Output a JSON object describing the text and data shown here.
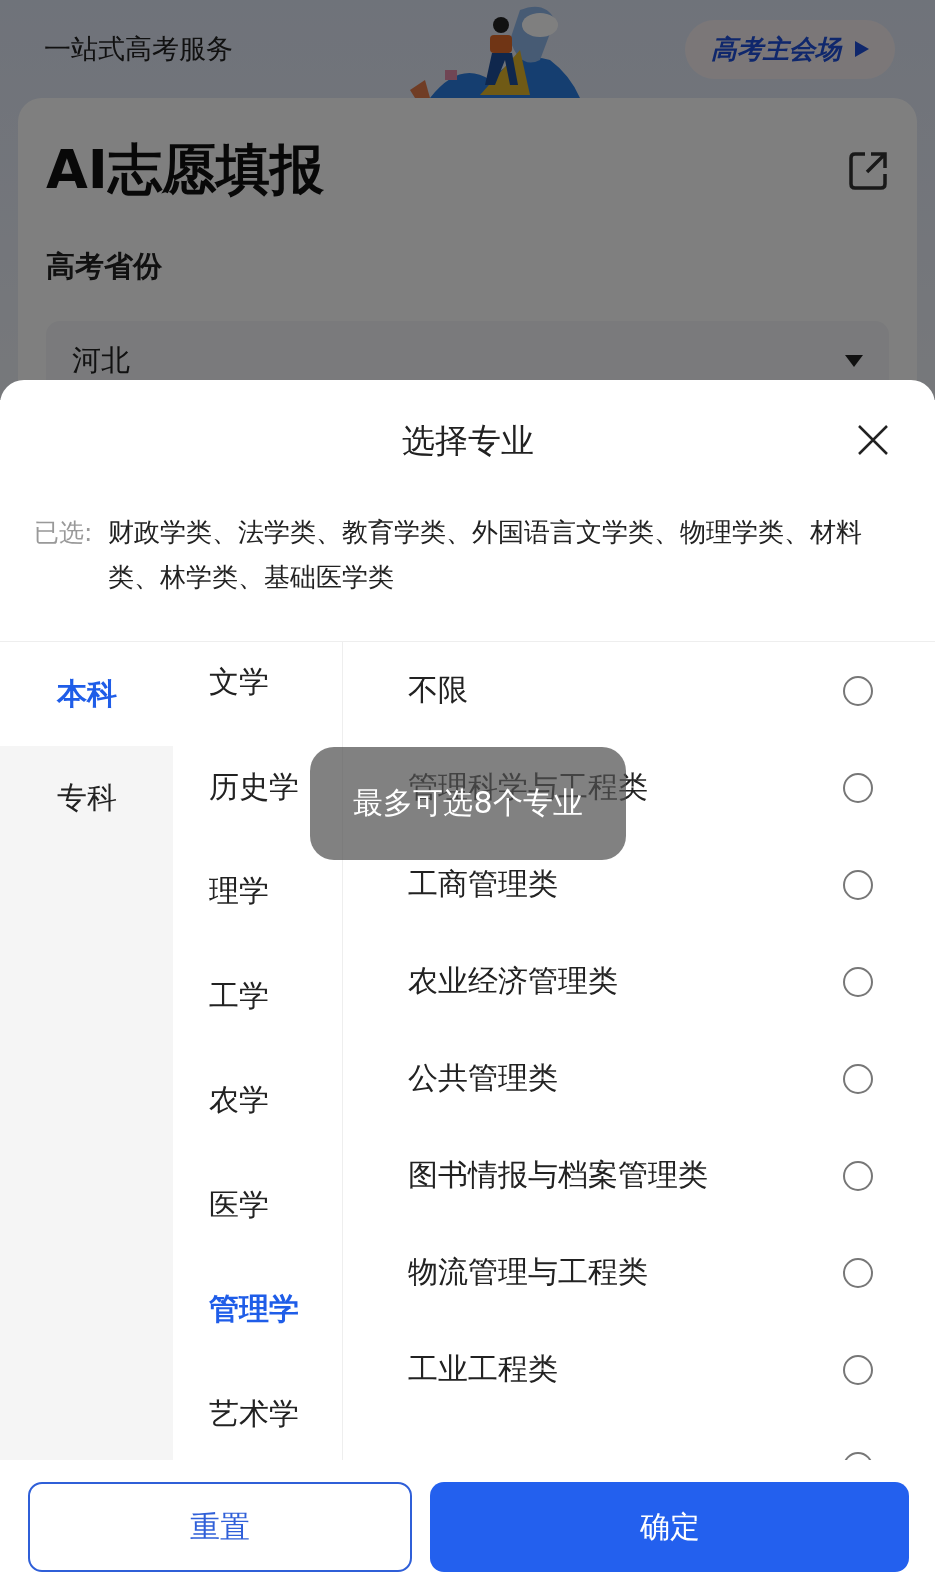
{
  "header": {
    "title": "一站式高考服务",
    "link": "高考主会场"
  },
  "card": {
    "title": "AI志愿填报",
    "province_label": "高考省份",
    "province": "河北"
  },
  "sheet": {
    "title": "选择专业",
    "selected_label": "已选:",
    "selected_text": "财政学类、法学类、教育学类、外国语言文学类、物理学类、材料类、林学类、基础医学类",
    "levels": [
      {
        "label": "本科",
        "selected": true
      },
      {
        "label": "专科",
        "selected": false
      }
    ],
    "disciplines": [
      {
        "label": "文学",
        "selected": false
      },
      {
        "label": "历史学",
        "selected": false
      },
      {
        "label": "理学",
        "selected": false
      },
      {
        "label": "工学",
        "selected": false
      },
      {
        "label": "农学",
        "selected": false
      },
      {
        "label": "医学",
        "selected": false
      },
      {
        "label": "管理学",
        "selected": true
      },
      {
        "label": "艺术学",
        "selected": false
      }
    ],
    "majors": [
      {
        "label": "不限",
        "checked": false
      },
      {
        "label": "管理科学与工程类",
        "checked": false
      },
      {
        "label": "工商管理类",
        "checked": false
      },
      {
        "label": "农业经济管理类",
        "checked": false
      },
      {
        "label": "公共管理类",
        "checked": false
      },
      {
        "label": "图书情报与档案管理类",
        "checked": false
      },
      {
        "label": "物流管理与工程类",
        "checked": false
      },
      {
        "label": "工业工程类",
        "checked": false
      },
      {
        "checked": false
      }
    ],
    "toast": "最多可选8个专业",
    "buttons": {
      "reset": "重置",
      "confirm": "确定"
    }
  }
}
